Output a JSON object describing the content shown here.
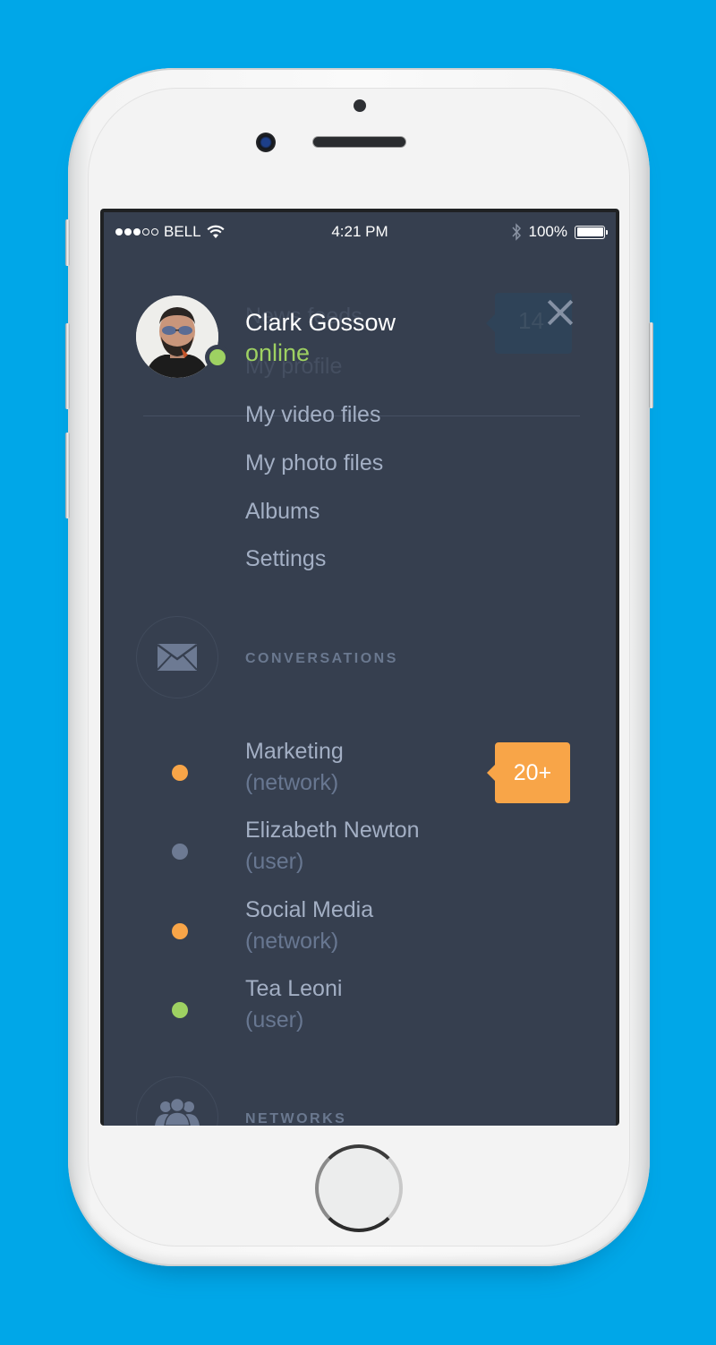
{
  "status_bar": {
    "signal_filled": 3,
    "signal_total": 5,
    "carrier": "BELL",
    "time": "4:21 PM",
    "battery_percent": "100%",
    "battery_level": 1.0
  },
  "profile": {
    "name": "Clark Gossow",
    "status": "online",
    "status_color": "#9ed162"
  },
  "ghost_menu": {
    "item_news": "News feeds",
    "item_profile": "My profile",
    "badge_count": "14"
  },
  "menu": {
    "items": [
      {
        "label": "My video files"
      },
      {
        "label": "My photo files"
      },
      {
        "label": "Albums"
      },
      {
        "label": "Settings"
      }
    ]
  },
  "sections": {
    "conversations": {
      "title": "CONVERSATIONS",
      "icon": "envelope-icon"
    },
    "networks": {
      "title": "NETWORKS",
      "icon": "group-icon"
    }
  },
  "conversations": [
    {
      "name": "Marketing",
      "type": "(network)",
      "dot_color": "#f8a548",
      "badge": "20+"
    },
    {
      "name": "Elizabeth Newton",
      "type": "(user)",
      "dot_color": "#6d7a93",
      "badge": null
    },
    {
      "name": "Social Media",
      "type": "(network)",
      "dot_color": "#f8a548",
      "badge": null
    },
    {
      "name": "Tea Leoni",
      "type": "(user)",
      "dot_color": "#9ed162",
      "badge": null
    }
  ]
}
